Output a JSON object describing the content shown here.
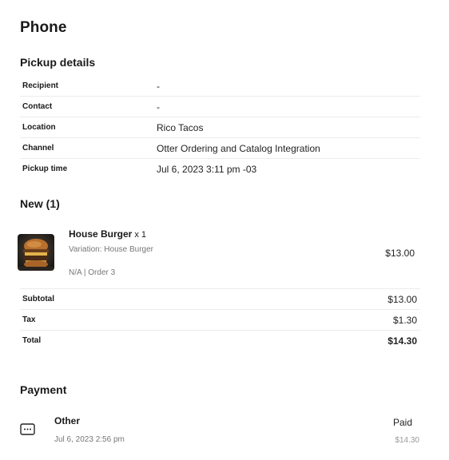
{
  "title": "Phone",
  "pickup": {
    "heading": "Pickup details",
    "rows": [
      {
        "label": "Recipient",
        "value": "-"
      },
      {
        "label": "Contact",
        "value": "-"
      },
      {
        "label": "Location",
        "value": "Rico Tacos"
      },
      {
        "label": "Channel",
        "value": "Otter Ordering and Catalog Integration"
      },
      {
        "label": "Pickup time",
        "value": "Jul 6, 2023 3:11 pm -03"
      }
    ]
  },
  "items_section": {
    "heading": "New (1)",
    "item": {
      "name": "House Burger",
      "qty": "x 1",
      "variation": "Variation: House Burger",
      "meta": "N/A | Order 3",
      "price": "$13.00",
      "image_icon": "burger-photo"
    }
  },
  "totals": [
    {
      "label": "Subtotal",
      "value": "$13.00"
    },
    {
      "label": "Tax",
      "value": "$1.30"
    },
    {
      "label": "Total",
      "value": "$14.30"
    }
  ],
  "payment": {
    "heading": "Payment",
    "method": "Other",
    "date": "Jul 6, 2023 2:56 pm",
    "status": "Paid",
    "amount": "$14.30",
    "icon": "card-icon"
  }
}
